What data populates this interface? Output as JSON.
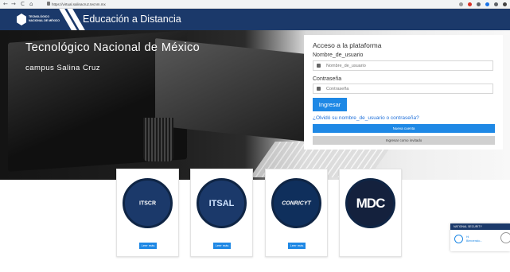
{
  "browser": {
    "back": "←",
    "forward": "→",
    "reload": "C",
    "home": "⌂",
    "url": "https://virtual.salinacruz.tecnm.mx",
    "ext_colors": [
      "#999999",
      "#d93025",
      "#5f6368",
      "#1a73e8",
      "#5f6368",
      "#444444"
    ]
  },
  "header": {
    "logo_text": "TECNOLÓGICO NACIONAL DE MÉXICO",
    "title": "Educación a Distancia",
    "colors": {
      "navy": "#1b396a",
      "accent": "#1e88e5"
    }
  },
  "hero": {
    "title": "Tecnológico Nacional de México",
    "subtitle": "campus Salina Cruz"
  },
  "login": {
    "heading": "Acceso a la plataforma",
    "username_label": "Nombre_de_usuario",
    "username_placeholder": "Nombre_de_usuario",
    "username_icon": "user-icon",
    "password_label": "Contraseña",
    "password_placeholder": "Contraseña",
    "password_icon": "lock-icon",
    "submit": "Ingresar",
    "forgot": "¿Olvidó su nombre_de_usuario o contraseña?",
    "new_account": "Nueva cuenta",
    "guest": "Ingresar como invitado"
  },
  "cards": [
    {
      "logo": "ITSCR",
      "button": "Leer más"
    },
    {
      "logo": "ITSAL",
      "button": "Leer más"
    },
    {
      "logo": "CONRICYT",
      "button": "Leer más"
    },
    {
      "logo": "MDC",
      "button": ""
    }
  ],
  "chat": {
    "header": "NATIONAL SECURITY",
    "line1": "Hi",
    "line2": "Bienvenido..."
  }
}
